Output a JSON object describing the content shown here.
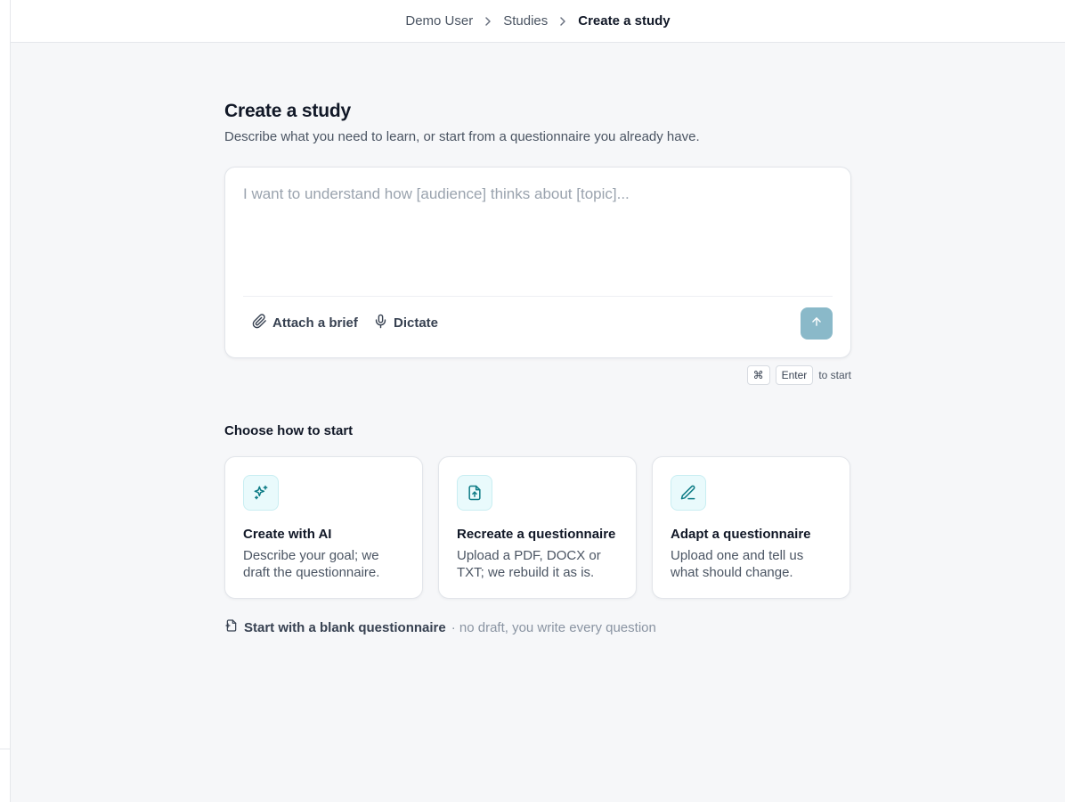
{
  "breadcrumb": {
    "items": [
      "Demo User",
      "Studies"
    ],
    "current": "Create a study"
  },
  "page": {
    "title": "Create a study",
    "subtitle": "Describe what you need to learn, or start from a questionnaire you already have."
  },
  "composer": {
    "placeholder": "I want to understand how [audience] thinks about [topic]...",
    "value": "",
    "attach_label": "Attach a brief",
    "dictate_label": "Dictate",
    "send_icon": "arrow-up-icon"
  },
  "shortcut": {
    "key1": "⌘",
    "key2": "Enter",
    "suffix": "to start"
  },
  "start": {
    "section_title": "Choose how to start",
    "options": [
      {
        "icon": "sparkles-icon",
        "title": "Create with AI",
        "description": "Describe your goal; we draft the questionnaire."
      },
      {
        "icon": "file-upload-icon",
        "title": "Recreate a questionnaire",
        "description": "Upload a PDF, DOCX or TXT; we rebuild it as is."
      },
      {
        "icon": "pencil-icon",
        "title": "Adapt a questionnaire",
        "description": "Upload one and tell us what should change."
      }
    ],
    "blank_label": "Start with a blank questionnaire",
    "blank_note": "· no draft, you write every question"
  },
  "colors": {
    "accent": "#0e7c86",
    "send_button": "#8ab9c9",
    "icon_bg": "#e9fafc"
  }
}
